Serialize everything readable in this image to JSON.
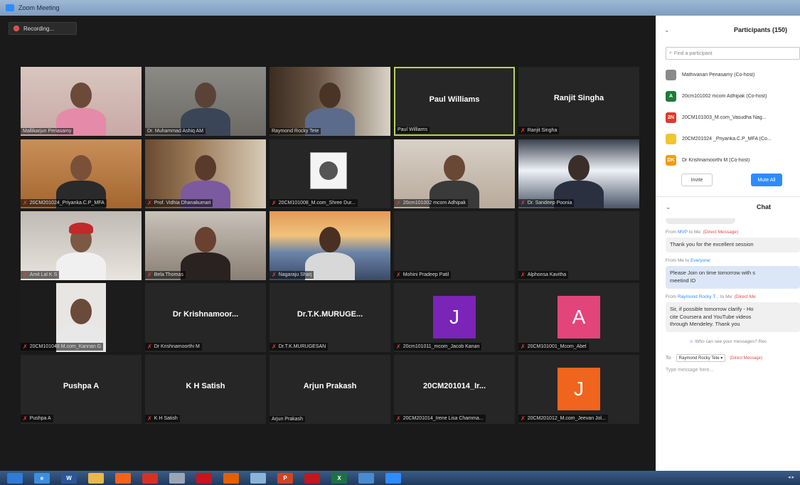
{
  "window": {
    "title": "Zoom Meeting"
  },
  "recording": {
    "label": "Recording..."
  },
  "tiles": [
    {
      "label": "Mallikarjun Periasamy",
      "center": "",
      "muted": false,
      "kind": "video",
      "theme": "pink"
    },
    {
      "label": "Dr. Muhammad Ashiq AM",
      "center": "",
      "muted": false,
      "kind": "video",
      "theme": "office"
    },
    {
      "label": "Raymond Rocky Tete",
      "center": "",
      "muted": false,
      "kind": "video",
      "theme": "shelf"
    },
    {
      "label": "Paul Williams",
      "center": "Paul Williams",
      "muted": false,
      "kind": "name",
      "active": true
    },
    {
      "label": "Ranjit Singha",
      "center": "Ranjit Singha",
      "muted": true,
      "kind": "name"
    },
    {
      "label": "20CM201024_Priyanka.C.P_MFA",
      "center": "",
      "muted": true,
      "kind": "video",
      "theme": "headset"
    },
    {
      "label": "Prof. Vidhia Dhanakumari",
      "center": "",
      "muted": true,
      "kind": "video",
      "theme": "shelf2"
    },
    {
      "label": "20CM101008_M.com_Shree Dur...",
      "center": "",
      "muted": true,
      "kind": "photo"
    },
    {
      "label": "20cm101002 mcom Adhipak",
      "center": "",
      "muted": true,
      "kind": "video",
      "theme": "room"
    },
    {
      "label": "Dr. Sandeep Poonia",
      "center": "",
      "muted": true,
      "kind": "video",
      "theme": "bright"
    },
    {
      "label": "Amit Lal K S",
      "center": "",
      "muted": true,
      "kind": "video",
      "theme": "turban"
    },
    {
      "label": "Bela Thomas",
      "center": "",
      "muted": true,
      "kind": "video",
      "theme": "closeup"
    },
    {
      "label": "Nagaraju Sharj",
      "center": "",
      "muted": true,
      "kind": "video",
      "theme": "bridge"
    },
    {
      "label": "Mohini Pradeep Patil",
      "center": "",
      "muted": true,
      "kind": "blank"
    },
    {
      "label": "Alphonsa Kavitha",
      "center": "",
      "muted": true,
      "kind": "blank"
    },
    {
      "label": "20CM101048 M.com_Kannan G",
      "center": "",
      "muted": true,
      "kind": "video",
      "theme": "small"
    },
    {
      "label": "Dr Krishnamoorthi M",
      "center": "Dr Krishnamoor...",
      "muted": true,
      "kind": "name"
    },
    {
      "label": "Dr.T.K.MURUGESAN",
      "center": "Dr.T.K.MURUGE...",
      "muted": true,
      "kind": "name"
    },
    {
      "label": "20cm101011_mcom_Jacob Kanan",
      "center": "J",
      "muted": true,
      "kind": "avatar",
      "color": "#7a24b8"
    },
    {
      "label": "20CM101001_Mcom_Abel",
      "center": "A",
      "muted": true,
      "kind": "avatar",
      "color": "#e2457a"
    },
    {
      "label": "Pushpa A",
      "center": "Pushpa A",
      "muted": true,
      "kind": "name"
    },
    {
      "label": "K H Satish",
      "center": "K H Satish",
      "muted": true,
      "kind": "name"
    },
    {
      "label": "Arjun Prakash",
      "center": "Arjun Prakash",
      "muted": false,
      "kind": "name"
    },
    {
      "label": "20CM201014_Irene Lisa Chamma...",
      "center": "20CM201014_Ir...",
      "muted": true,
      "kind": "name"
    },
    {
      "label": "20CM201012_M.com_Jeevan Jol...",
      "center": "J",
      "muted": true,
      "kind": "avatar",
      "color": "#f0641e"
    }
  ],
  "participants": {
    "title": "Participants (150)",
    "search_placeholder": "Find a participant",
    "list": [
      {
        "initials": "",
        "name": "Mathivanan Periasamy (Co-host)",
        "color": "#8a8a8a",
        "photo": true
      },
      {
        "initials": "A",
        "name": "20cm101002 mcom Adhipak (Co-host)",
        "color": "#1f7a3a"
      },
      {
        "initials": "2N",
        "name": "20CM101003_M.com_Vasudha Nag...",
        "color": "#e0382f"
      },
      {
        "initials": "",
        "name": "20CM201024 _Priyanka.C.P_MFA (Co...",
        "color": "#f3c52c",
        "photo": true
      },
      {
        "initials": "DK",
        "name": "Dr Krishnamoorthi M (Co-host)",
        "color": "#f39c12"
      }
    ],
    "invite": "Invite",
    "mute_all": "Mute All"
  },
  "chat": {
    "title": "Chat",
    "messages": [
      {
        "from": "From ",
        "sender": "MVP",
        "to": " to Me: ",
        "tag": "(Direct Message)",
        "text": [
          "Thank you for the excellent session"
        ],
        "me": false
      },
      {
        "from": "From Me to ",
        "sender": "Everyone",
        "to": ":",
        "tag": "",
        "text": [
          "Please Join on time tomorrow with s",
          "meetind ID"
        ],
        "me": true
      },
      {
        "from": "From ",
        "sender": "Raymond Rocky T...",
        "to": " to Me: ",
        "tag": "(Direct Me",
        "text": [
          "Sir, if possible tomorrow clarify - Ho",
          "cite Coursera and YouTube videos",
          "through Mendeley. Thank you"
        ],
        "me": false
      }
    ],
    "who_can_see": "Who can see your messages? Rec",
    "to_label": "To:",
    "to_value": "Raymond Rocky Tete ▾",
    "to_tag": "(Direct Message)",
    "type_placeholder": "Type message here..."
  },
  "taskbar": {
    "icons": [
      {
        "name": "start-orb-icon",
        "color": "#2f7bd6",
        "glyph": ""
      },
      {
        "name": "ie-icon",
        "color": "#3b8fe0",
        "glyph": "e"
      },
      {
        "name": "word-icon",
        "color": "#2b5797",
        "glyph": "W"
      },
      {
        "name": "folder-icon",
        "color": "#e8b84a",
        "glyph": ""
      },
      {
        "name": "media-player-icon",
        "color": "#f0641e",
        "glyph": ""
      },
      {
        "name": "chrome-icon",
        "color": "#d93025",
        "glyph": ""
      },
      {
        "name": "paint-icon",
        "color": "#9aa6b8",
        "glyph": ""
      },
      {
        "name": "acrobat-icon",
        "color": "#c4161c",
        "glyph": ""
      },
      {
        "name": "firefox-icon",
        "color": "#e66000",
        "glyph": ""
      },
      {
        "name": "notepad-icon",
        "color": "#8ab4d8",
        "glyph": ""
      },
      {
        "name": "powerpoint-icon",
        "color": "#d04423",
        "glyph": "P"
      },
      {
        "name": "pdf-icon",
        "color": "#c4161c",
        "glyph": ""
      },
      {
        "name": "excel-icon",
        "color": "#1e7145",
        "glyph": "X"
      },
      {
        "name": "display-icon",
        "color": "#4a8ad0",
        "glyph": ""
      },
      {
        "name": "zoom-icon",
        "color": "#2d8cff",
        "glyph": ""
      }
    ]
  }
}
